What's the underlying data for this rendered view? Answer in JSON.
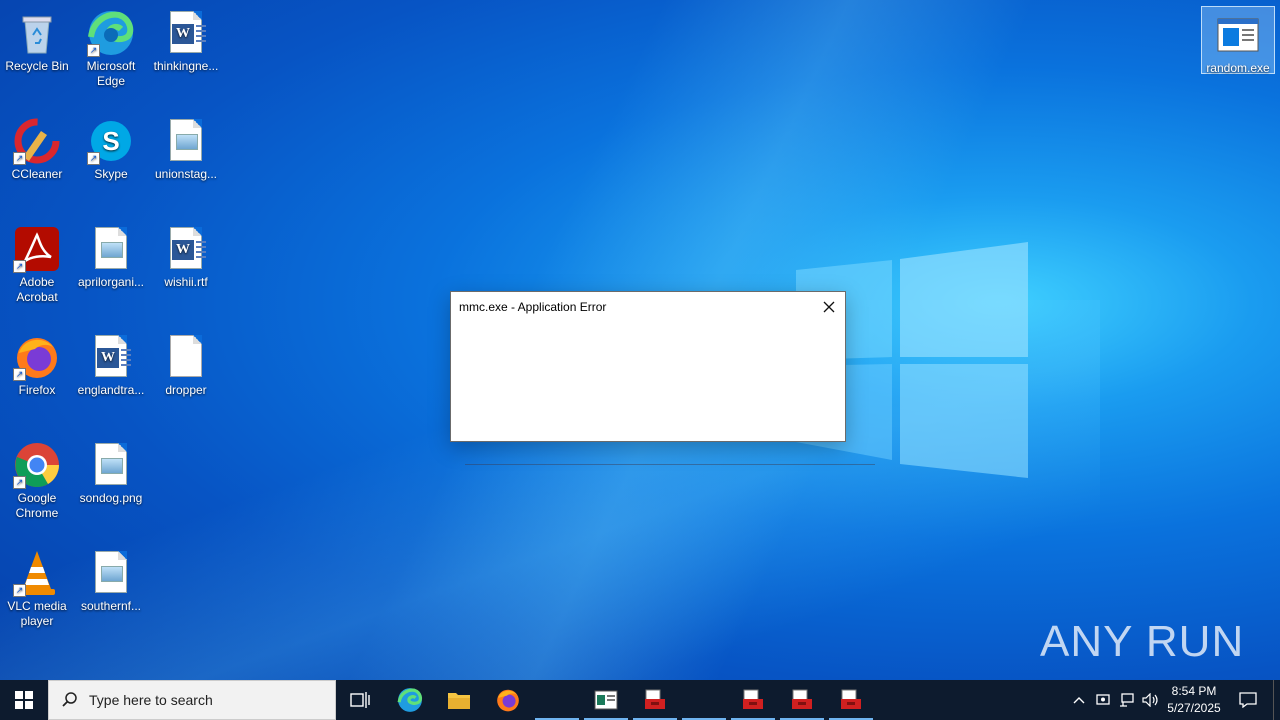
{
  "desktop": {
    "icons": [
      {
        "label": "Recycle Bin"
      },
      {
        "label": "Microsoft Edge"
      },
      {
        "label": "thinkingne..."
      },
      {
        "label": "CCleaner"
      },
      {
        "label": "Skype"
      },
      {
        "label": "unionstag..."
      },
      {
        "label": "Adobe Acrobat"
      },
      {
        "label": "aprilorgani..."
      },
      {
        "label": "wishii.rtf"
      },
      {
        "label": "Firefox"
      },
      {
        "label": "englandtra..."
      },
      {
        "label": "dropper"
      },
      {
        "label": "Google Chrome"
      },
      {
        "label": "sondog.png"
      },
      {
        "label": "VLC media player"
      },
      {
        "label": "southernf..."
      },
      {
        "label": "random.exe"
      }
    ]
  },
  "dialog": {
    "title": "mmc.exe - Application Error",
    "close_icon": "close-icon"
  },
  "watermark": {
    "text": "ANY RUN"
  },
  "taskbar": {
    "search_placeholder": "Type here to search",
    "clock_time": "8:54 PM",
    "clock_date": "5/27/2025"
  },
  "colors": {
    "desktop_accent": "#0a72dd",
    "taskbar_bg": "#0d1b2e",
    "active_indicator": "#6fb4f0"
  }
}
